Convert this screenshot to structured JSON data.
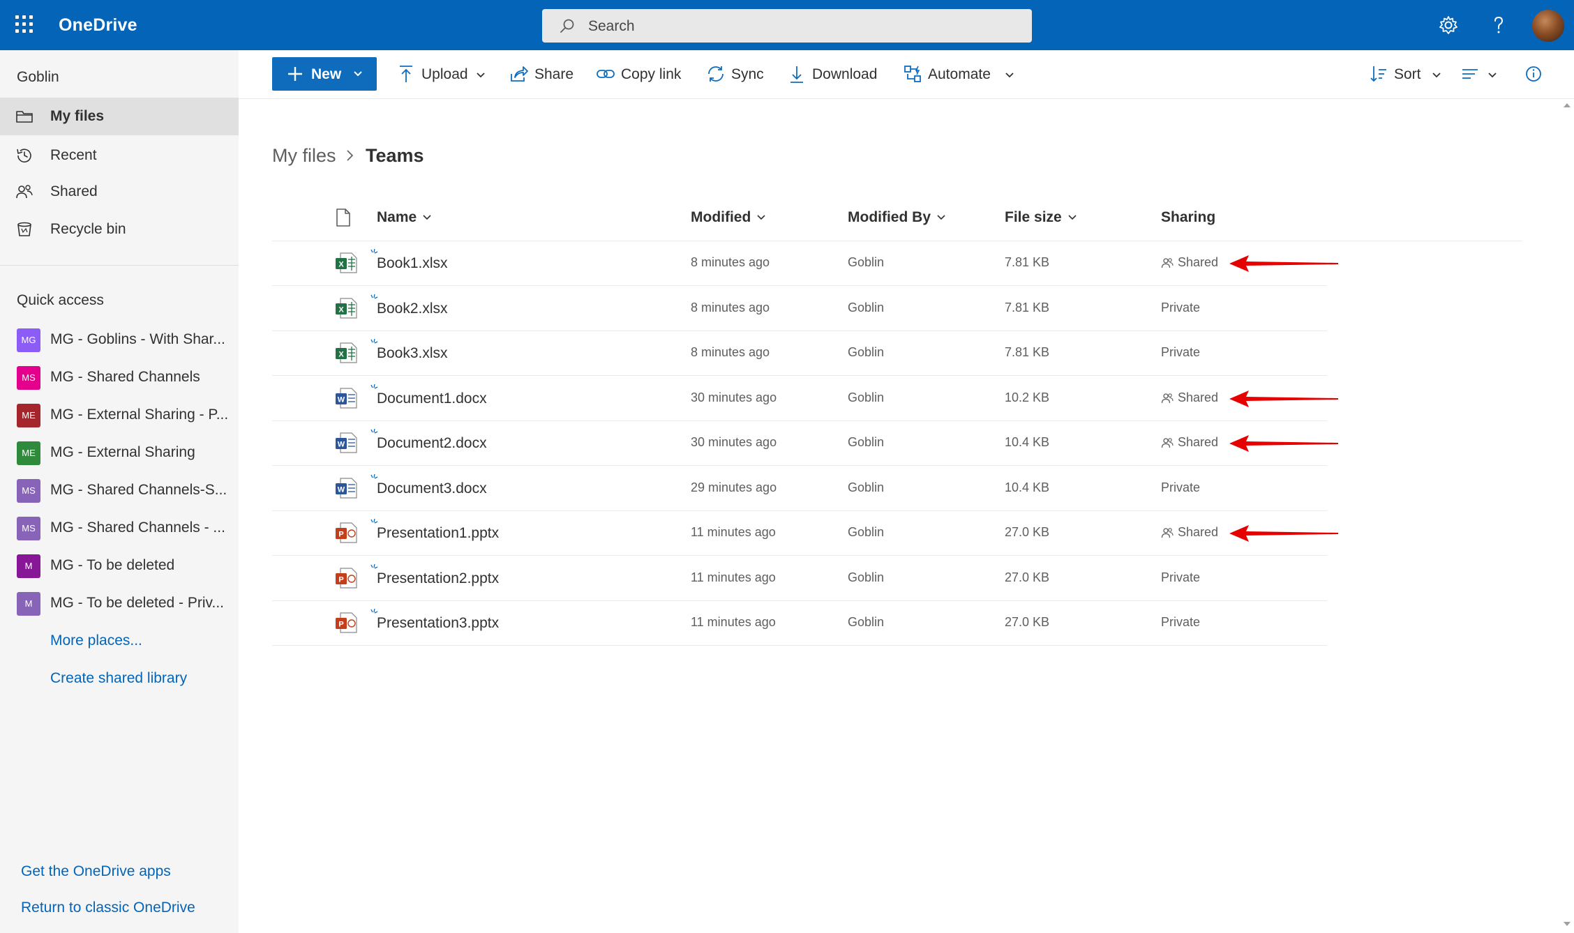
{
  "app": {
    "brand": "OneDrive",
    "search_placeholder": "Search"
  },
  "sidebar": {
    "user": "Goblin",
    "nav": [
      {
        "label": "My files",
        "icon": "folder-icon",
        "active": true
      },
      {
        "label": "Recent",
        "icon": "history-icon",
        "active": false
      },
      {
        "label": "Shared",
        "icon": "people-icon",
        "active": false
      },
      {
        "label": "Recycle bin",
        "icon": "trash-icon",
        "active": false
      }
    ],
    "quick_access_title": "Quick access",
    "quick_access": [
      {
        "badge": "MG",
        "label": "MG - Goblins - With Shar...",
        "color": "#8b5cf6"
      },
      {
        "badge": "MS",
        "label": "MG - Shared Channels",
        "color": "#e3008c"
      },
      {
        "badge": "ME",
        "label": "MG - External Sharing - P...",
        "color": "#a4262c"
      },
      {
        "badge": "ME",
        "label": "MG - External Sharing",
        "color": "#2f8a3c"
      },
      {
        "badge": "MS",
        "label": "MG - Shared Channels-S...",
        "color": "#8764b8"
      },
      {
        "badge": "MS",
        "label": "MG - Shared Channels - ...",
        "color": "#8764b8"
      },
      {
        "badge": "M",
        "label": "MG - To be deleted",
        "color": "#881798"
      },
      {
        "badge": "M",
        "label": "MG - To be deleted - Priv...",
        "color": "#8764b8"
      }
    ],
    "more_places": "More places...",
    "create_library": "Create shared library",
    "get_apps": "Get the OneDrive apps",
    "return_classic": "Return to classic OneDrive"
  },
  "toolbar": {
    "new": "New",
    "upload": "Upload",
    "share": "Share",
    "copy_link": "Copy link",
    "sync": "Sync",
    "download": "Download",
    "automate": "Automate",
    "sort": "Sort"
  },
  "breadcrumb": {
    "root": "My files",
    "current": "Teams"
  },
  "table": {
    "columns": {
      "name": "Name",
      "modified": "Modified",
      "modified_by": "Modified By",
      "file_size": "File size",
      "sharing": "Sharing"
    },
    "rows": [
      {
        "name": "Book1.xlsx",
        "type": "excel",
        "modified": "8 minutes ago",
        "modified_by": "Goblin",
        "size": "7.81 KB",
        "sharing": "Shared"
      },
      {
        "name": "Book2.xlsx",
        "type": "excel",
        "modified": "8 minutes ago",
        "modified_by": "Goblin",
        "size": "7.81 KB",
        "sharing": "Private"
      },
      {
        "name": "Book3.xlsx",
        "type": "excel",
        "modified": "8 minutes ago",
        "modified_by": "Goblin",
        "size": "7.81 KB",
        "sharing": "Private"
      },
      {
        "name": "Document1.docx",
        "type": "word",
        "modified": "30 minutes ago",
        "modified_by": "Goblin",
        "size": "10.2 KB",
        "sharing": "Shared"
      },
      {
        "name": "Document2.docx",
        "type": "word",
        "modified": "30 minutes ago",
        "modified_by": "Goblin",
        "size": "10.4 KB",
        "sharing": "Shared"
      },
      {
        "name": "Document3.docx",
        "type": "word",
        "modified": "29 minutes ago",
        "modified_by": "Goblin",
        "size": "10.4 KB",
        "sharing": "Private"
      },
      {
        "name": "Presentation1.pptx",
        "type": "powerpoint",
        "modified": "11 minutes ago",
        "modified_by": "Goblin",
        "size": "27.0 KB",
        "sharing": "Shared"
      },
      {
        "name": "Presentation2.pptx",
        "type": "powerpoint",
        "modified": "11 minutes ago",
        "modified_by": "Goblin",
        "size": "27.0 KB",
        "sharing": "Private"
      },
      {
        "name": "Presentation3.pptx",
        "type": "powerpoint",
        "modified": "11 minutes ago",
        "modified_by": "Goblin",
        "size": "27.0 KB",
        "sharing": "Private"
      }
    ]
  },
  "colors": {
    "brand_blue": "#0364b8",
    "excel": "#217346",
    "word": "#2b579a",
    "powerpoint": "#c43e1c",
    "annotation_arrow": "#e60000"
  }
}
